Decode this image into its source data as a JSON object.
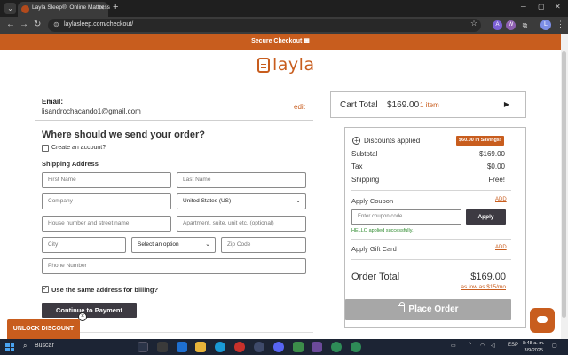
{
  "browser": {
    "tab_title": "Layla Sleep®: Online Mattress",
    "url": "laylasleep.com/checkout/",
    "profile_initial": "L",
    "ext_initials": [
      "A",
      "W"
    ]
  },
  "page": {
    "secure_checkout": "Secure Checkout",
    "brand_name": "layla"
  },
  "contact": {
    "email_label": "Email:",
    "email_value": "lisandrochacando1@gmail.com",
    "edit_label": "edit"
  },
  "shipping": {
    "heading": "Where should we send your order?",
    "create_account": "Create an account?",
    "address_heading": "Shipping Address",
    "first_name_ph": "First Name",
    "last_name_ph": "Last Name",
    "company_ph": "Company",
    "country_value": "United States (US)",
    "street_ph": "House number and street name",
    "apartment_ph": "Apartment, suite, unit etc. (optional)",
    "city_ph": "City",
    "state_value": "Select an option",
    "zip_ph": "Zip Code",
    "phone_ph": "Phone Number",
    "same_billing": "Use the same address for billing?",
    "same_billing_checked": true,
    "continue_label": "Continue to Payment"
  },
  "promo": {
    "unlock_label": "UNLOCK DISCOUNT",
    "close_glyph": "×"
  },
  "cart": {
    "label": "Cart Total",
    "total": "$169.00",
    "items": "1 item"
  },
  "summary": {
    "discounts_label": "Discounts applied",
    "savings_badge": "$60.00 in Savings!",
    "subtotal_label": "Subtotal",
    "subtotal_value": "$169.00",
    "tax_label": "Tax",
    "tax_value": "$0.00",
    "shipping_label": "Shipping",
    "shipping_value": "Free!",
    "coupon_label": "Apply Coupon",
    "coupon_add": "ADD",
    "coupon_ph": "Enter coupon code",
    "apply_label": "Apply",
    "coupon_success": "HELLO applied successfully.",
    "gift_label": "Apply Gift Card",
    "gift_add": "ADD",
    "order_total_label": "Order Total",
    "order_total_value": "$169.00",
    "low_as": "as low as $15/mo",
    "place_order": "Place Order"
  },
  "taskbar": {
    "search_label": "Buscar",
    "lang": "ESP",
    "time": "8:48 a. m.",
    "date": "3/9/2025"
  },
  "colors": {
    "brand": "#c85d1e",
    "dark_button": "#3d3a42",
    "disabled_button": "#a7a7a7",
    "success": "#2d8a2d"
  }
}
